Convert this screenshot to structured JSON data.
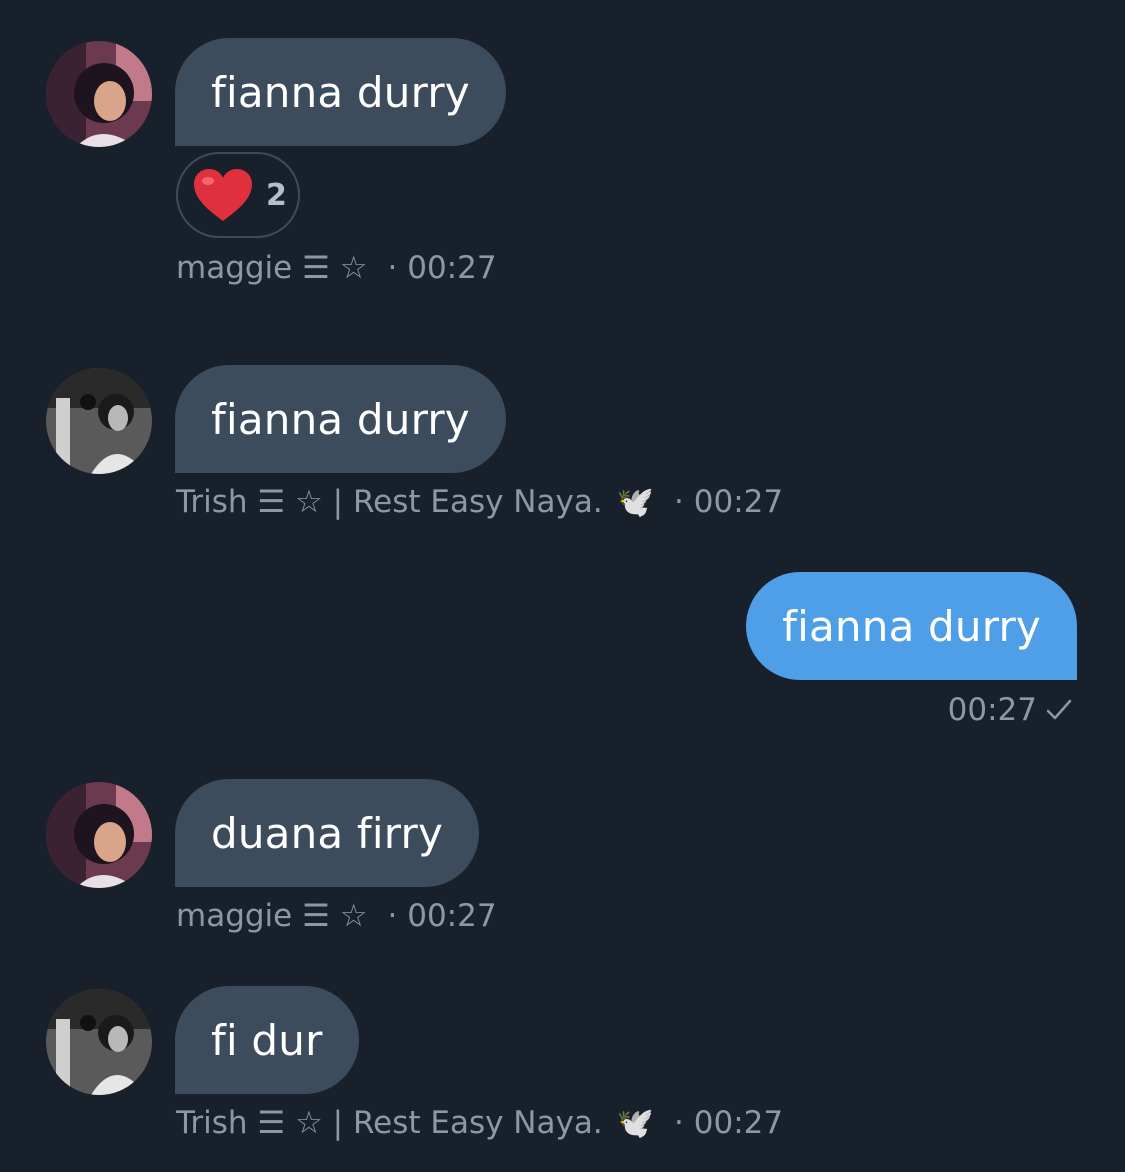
{
  "messages": [
    {
      "text": "fianna durry",
      "sender": "maggie ☰ ☆",
      "time": "· 00:27",
      "reaction": {
        "emoji": "heart-icon",
        "count": "2"
      }
    },
    {
      "text": "fianna durry",
      "sender": "Trish ☰ ☆ | Rest Easy Naya.",
      "sender_emoji": "🕊️",
      "time": "· 00:27"
    },
    {
      "text": "fianna durry",
      "time": "00:27",
      "status": "sent-check-icon"
    },
    {
      "text": "duana firry",
      "sender": "maggie ☰ ☆",
      "time": "· 00:27"
    },
    {
      "text": "fi dur",
      "sender": "Trish ☰ ☆ | Rest Easy Naya.",
      "sender_emoji": "🕊️",
      "time": "· 00:27"
    }
  ],
  "colors": {
    "background": "#18202b",
    "incoming_bubble": "#3d4c5c",
    "outgoing_bubble": "#4e9fe7",
    "meta_text": "#8c98a6",
    "heart": "#e0303d"
  }
}
